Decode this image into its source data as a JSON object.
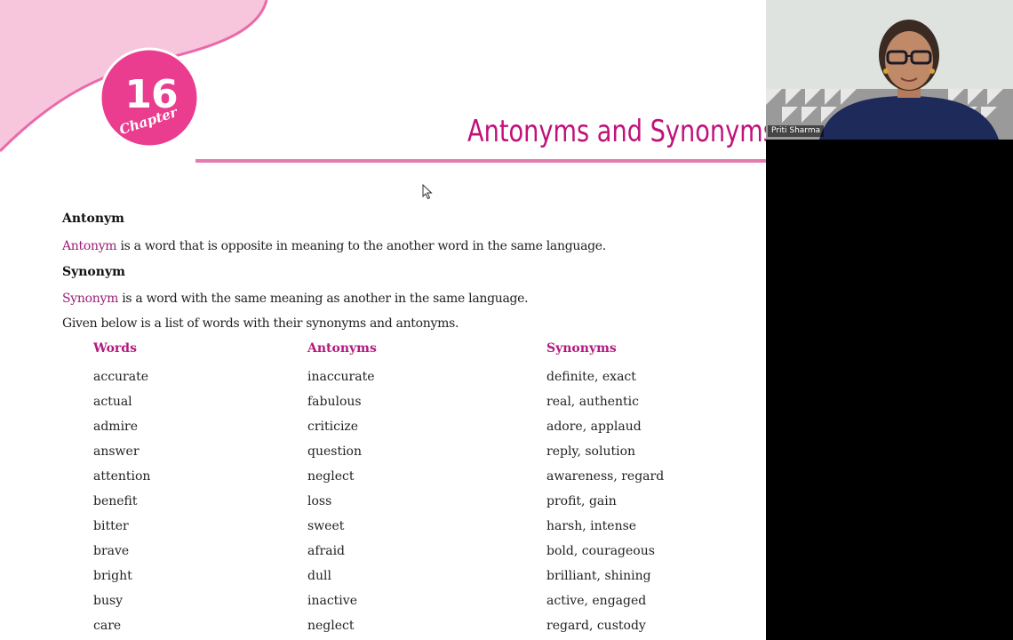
{
  "colors": {
    "accent": "#c0127a",
    "term": "#9c1e78",
    "pink_light": "#f7c6dd",
    "pink_mid": "#ea6aa9",
    "rule": "#e47bb0"
  },
  "chapter": {
    "number": "16",
    "word": "Chapter"
  },
  "page_title": "Antonyms and Synonyms",
  "antonym": {
    "heading": "Antonym",
    "term": "Antonym",
    "definition": " is a word that is opposite in meaning to the another word in the same language."
  },
  "synonym": {
    "heading": "Synonym",
    "term": "Synonym",
    "definition": " is a word with the same meaning as another in the same language."
  },
  "intro": "Given below is a list of words with their synonyms and antonyms.",
  "table": {
    "headers": [
      "Words",
      "Antonyms",
      "Synonyms"
    ],
    "rows": [
      [
        "accurate",
        "inaccurate",
        "definite, exact"
      ],
      [
        "actual",
        "fabulous",
        "real, authentic"
      ],
      [
        "admire",
        "criticize",
        "adore, applaud"
      ],
      [
        "answer",
        "question",
        "reply, solution"
      ],
      [
        "attention",
        "neglect",
        "awareness, regard"
      ],
      [
        "benefit",
        "loss",
        "profit, gain"
      ],
      [
        "bitter",
        "sweet",
        "harsh, intense"
      ],
      [
        "brave",
        "afraid",
        "bold, courageous"
      ],
      [
        "bright",
        "dull",
        "brilliant, shining"
      ],
      [
        "busy",
        "inactive",
        "active, engaged"
      ],
      [
        "care",
        "neglect",
        "regard, custody"
      ]
    ]
  },
  "video": {
    "participant_name": "Priti Sharma"
  },
  "icons": {
    "cursor": "mouse-pointer-icon"
  }
}
